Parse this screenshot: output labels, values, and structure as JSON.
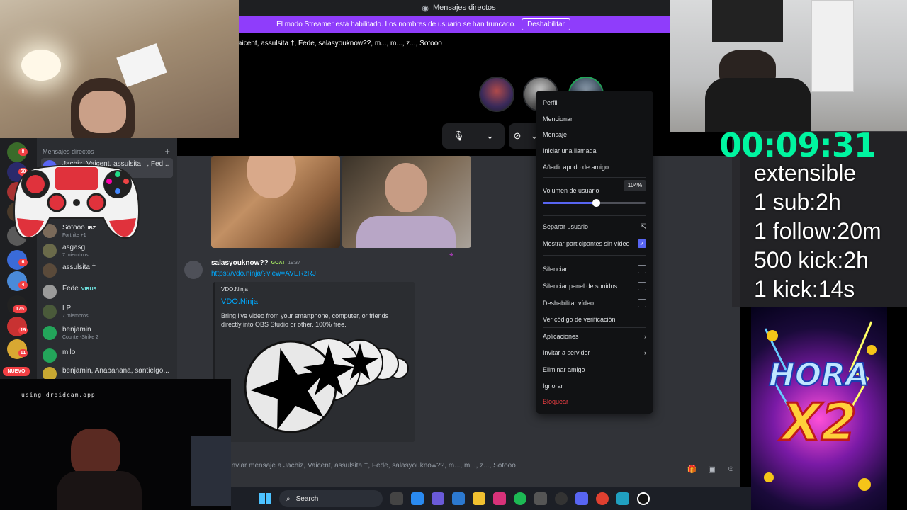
{
  "discord": {
    "window_title": "Mensajes directos",
    "streamer_banner": {
      "text": "El modo Streamer está habilitado. Los nombres de usuario se han truncado.",
      "button": "Deshabilitar"
    },
    "call": {
      "title": "Vaicent, assulsita †, Fede, salasyouknow??, m..., m..., z..., Sotooo"
    },
    "message": {
      "user": "salasyouknow??",
      "tag": "GOAT",
      "time": "19:37",
      "link": "https://vdo.ninja/?view=AVERzRJ",
      "embed": {
        "provider": "VDO.Ninja",
        "title": "VDO.Ninja",
        "description": "Bring live video from your smartphone, computer, or friends directly into OBS Studio or other. 100% free."
      }
    },
    "composer_placeholder": "Enviar mensaje a Jachiz, Vaicent, assulsita †, Fede, salasyouknow??, m..., m..., z..., Sotooo"
  },
  "sidebar": {
    "header": "Mensajes directos",
    "new_badge": "NUEVO",
    "server_badges": [
      "8",
      "60",
      "6",
      "4",
      "175",
      "19",
      "11"
    ],
    "dms": [
      {
        "name": "Jachiz, Vaicent, assulsita †, Fed...",
        "sub": ""
      },
      {
        "name": "Sotooo",
        "badge": "IBZ",
        "sub": "Fortnite +1"
      },
      {
        "name": "asgasg",
        "sub": "7 miembros"
      },
      {
        "name": "assulsita †",
        "sub": ""
      },
      {
        "name": "Fede",
        "badge": "VIRUS",
        "sub": ""
      },
      {
        "name": "LP",
        "sub": "7 miembros"
      },
      {
        "name": "benjamin",
        "sub": "Counter-Strike 2"
      },
      {
        "name": "milo",
        "sub": ""
      },
      {
        "name": "benjamin, Anabanana, santielgo...",
        "sub": ""
      }
    ]
  },
  "context_menu": {
    "items_top": [
      "Perfil",
      "Mencionar",
      "Mensaje",
      "Iniciar una llamada",
      "Añadir apodo de amigo"
    ],
    "volume_label": "Volumen de usuario",
    "volume_pct": "104%",
    "volume_value": 104,
    "separar": "Separar usuario",
    "mostrar": "Mostrar participantes sin vídeo",
    "silenciar": "Silenciar",
    "silenciar_panel": "Silenciar panel de sonidos",
    "deshabilitar_video": "Deshabilitar vídeo",
    "ver_codigo": "Ver código de verificación",
    "aplicaciones": "Aplicaciones",
    "invitar": "Invitar a servidor",
    "eliminar": "Eliminar amigo",
    "ignorar": "Ignorar",
    "bloquear": "Bloquear"
  },
  "overlay": {
    "timer": "00:09:31",
    "goals": [
      "extensible",
      "1 sub:2h",
      "1 follow:20m",
      "500 kick:2h",
      "1 kick:14s"
    ],
    "hora_line1": "HORA",
    "hora_line2": "X2",
    "droidcam": "using droidcam.app"
  },
  "taskbar": {
    "search": "Search"
  }
}
